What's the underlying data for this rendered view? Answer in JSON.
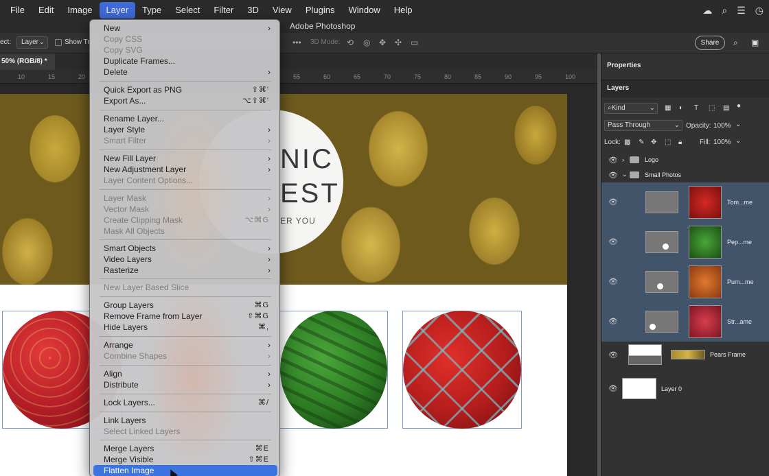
{
  "menubar": {
    "items": [
      "File",
      "Edit",
      "Image",
      "Layer",
      "Type",
      "Select",
      "Filter",
      "3D",
      "View",
      "Plugins",
      "Window",
      "Help"
    ],
    "active": "Layer"
  },
  "app_title": "Adobe Photoshop",
  "options_bar": {
    "select_label": "ect:",
    "select_value": "Layer",
    "show_label": "Show Tr",
    "mode_label": "3D Mode:",
    "share_label": "Share"
  },
  "doc_tab": "50% (RGB/8) *",
  "ruler_ticks": [
    "10",
    "15",
    "20",
    "55",
    "60",
    "65",
    "70",
    "75",
    "80",
    "85",
    "90",
    "95",
    "100"
  ],
  "artboard": {
    "badge_line1": "NIC",
    "badge_line2": "EST",
    "badge_line3": "ER YOU"
  },
  "layer_menu": {
    "items": [
      {
        "label": "New",
        "shortcut": "",
        "submenu": true,
        "disabled": false,
        "highlight": false
      },
      {
        "label": "Copy CSS",
        "shortcut": "",
        "submenu": false,
        "disabled": true,
        "highlight": false
      },
      {
        "label": "Copy SVG",
        "shortcut": "",
        "submenu": false,
        "disabled": true,
        "highlight": false
      },
      {
        "label": "Duplicate Frames...",
        "shortcut": "",
        "submenu": false,
        "disabled": false,
        "highlight": false
      },
      {
        "label": "Delete",
        "shortcut": "",
        "submenu": true,
        "disabled": false,
        "highlight": false
      },
      {
        "label": "Quick Export as PNG",
        "shortcut": "⇧⌘'",
        "submenu": false,
        "disabled": false,
        "highlight": false
      },
      {
        "label": "Export As...",
        "shortcut": "⌥⇧⌘'",
        "submenu": false,
        "disabled": false,
        "highlight": false
      },
      {
        "label": "Rename Layer...",
        "shortcut": "",
        "submenu": false,
        "disabled": false,
        "highlight": false
      },
      {
        "label": "Layer Style",
        "shortcut": "",
        "submenu": true,
        "disabled": false,
        "highlight": false
      },
      {
        "label": "Smart Filter",
        "shortcut": "",
        "submenu": true,
        "disabled": true,
        "highlight": false
      },
      {
        "label": "New Fill Layer",
        "shortcut": "",
        "submenu": true,
        "disabled": false,
        "highlight": false
      },
      {
        "label": "New Adjustment Layer",
        "shortcut": "",
        "submenu": true,
        "disabled": false,
        "highlight": false
      },
      {
        "label": "Layer Content Options...",
        "shortcut": "",
        "submenu": false,
        "disabled": true,
        "highlight": false
      },
      {
        "label": "Layer Mask",
        "shortcut": "",
        "submenu": true,
        "disabled": true,
        "highlight": false
      },
      {
        "label": "Vector Mask",
        "shortcut": "",
        "submenu": true,
        "disabled": true,
        "highlight": false
      },
      {
        "label": "Create Clipping Mask",
        "shortcut": "⌥⌘G",
        "submenu": false,
        "disabled": true,
        "highlight": false
      },
      {
        "label": "Mask All Objects",
        "shortcut": "",
        "submenu": false,
        "disabled": true,
        "highlight": false
      },
      {
        "label": "Smart Objects",
        "shortcut": "",
        "submenu": true,
        "disabled": false,
        "highlight": false
      },
      {
        "label": "Video Layers",
        "shortcut": "",
        "submenu": true,
        "disabled": false,
        "highlight": false
      },
      {
        "label": "Rasterize",
        "shortcut": "",
        "submenu": true,
        "disabled": false,
        "highlight": false
      },
      {
        "label": "New Layer Based Slice",
        "shortcut": "",
        "submenu": false,
        "disabled": true,
        "highlight": false
      },
      {
        "label": "Group Layers",
        "shortcut": "⌘G",
        "submenu": false,
        "disabled": false,
        "highlight": false
      },
      {
        "label": "Remove Frame from Layer",
        "shortcut": "⇧⌘G",
        "submenu": false,
        "disabled": false,
        "highlight": false
      },
      {
        "label": "Hide Layers",
        "shortcut": "⌘,",
        "submenu": false,
        "disabled": false,
        "highlight": false
      },
      {
        "label": "Arrange",
        "shortcut": "",
        "submenu": true,
        "disabled": false,
        "highlight": false
      },
      {
        "label": "Combine Shapes",
        "shortcut": "",
        "submenu": true,
        "disabled": true,
        "highlight": false
      },
      {
        "label": "Align",
        "shortcut": "",
        "submenu": true,
        "disabled": false,
        "highlight": false
      },
      {
        "label": "Distribute",
        "shortcut": "",
        "submenu": true,
        "disabled": false,
        "highlight": false
      },
      {
        "label": "Lock Layers...",
        "shortcut": "⌘/",
        "submenu": false,
        "disabled": false,
        "highlight": false
      },
      {
        "label": "Link Layers",
        "shortcut": "",
        "submenu": false,
        "disabled": false,
        "highlight": false
      },
      {
        "label": "Select Linked Layers",
        "shortcut": "",
        "submenu": false,
        "disabled": true,
        "highlight": false
      },
      {
        "label": "Merge Layers",
        "shortcut": "⌘E",
        "submenu": false,
        "disabled": false,
        "highlight": false
      },
      {
        "label": "Merge Visible",
        "shortcut": "⇧⌘E",
        "submenu": false,
        "disabled": false,
        "highlight": false
      },
      {
        "label": "Flatten Image",
        "shortcut": "",
        "submenu": false,
        "disabled": false,
        "highlight": true
      }
    ]
  },
  "panels": {
    "properties_tab": "Properties",
    "layers_tab": "Layers",
    "kind_filter": "Kind",
    "blend_mode": "Pass Through",
    "opacity_label": "Opacity:",
    "opacity_value": "100%",
    "lock_label": "Lock:",
    "fill_label": "Fill:",
    "fill_value": "100%",
    "layers": [
      {
        "name": "Logo",
        "type": "group",
        "expanded": false,
        "selected": false
      },
      {
        "name": "Small Photos",
        "type": "group",
        "expanded": true,
        "selected": false
      },
      {
        "name": "Tom...me",
        "type": "frame",
        "selected": true
      },
      {
        "name": "Pep...me",
        "type": "frame",
        "selected": true
      },
      {
        "name": "Pum...me",
        "type": "frame",
        "selected": true
      },
      {
        "name": "Str...ame",
        "type": "frame",
        "selected": true
      },
      {
        "name": "Pears Frame",
        "type": "frame",
        "selected": false
      },
      {
        "name": "Layer 0",
        "type": "pixel",
        "selected": false
      }
    ]
  },
  "colors": {
    "menu_highlight": "#3b74e0",
    "selected_layer": "#42546a"
  }
}
